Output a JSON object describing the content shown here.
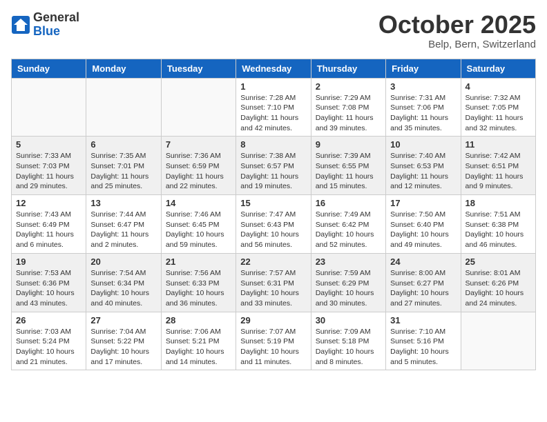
{
  "header": {
    "logo_general": "General",
    "logo_blue": "Blue",
    "month_title": "October 2025",
    "subtitle": "Belp, Bern, Switzerland"
  },
  "weekdays": [
    "Sunday",
    "Monday",
    "Tuesday",
    "Wednesday",
    "Thursday",
    "Friday",
    "Saturday"
  ],
  "weeks": [
    [
      {
        "day": "",
        "info": ""
      },
      {
        "day": "",
        "info": ""
      },
      {
        "day": "",
        "info": ""
      },
      {
        "day": "1",
        "info": "Sunrise: 7:28 AM\nSunset: 7:10 PM\nDaylight: 11 hours\nand 42 minutes."
      },
      {
        "day": "2",
        "info": "Sunrise: 7:29 AM\nSunset: 7:08 PM\nDaylight: 11 hours\nand 39 minutes."
      },
      {
        "day": "3",
        "info": "Sunrise: 7:31 AM\nSunset: 7:06 PM\nDaylight: 11 hours\nand 35 minutes."
      },
      {
        "day": "4",
        "info": "Sunrise: 7:32 AM\nSunset: 7:05 PM\nDaylight: 11 hours\nand 32 minutes."
      }
    ],
    [
      {
        "day": "5",
        "info": "Sunrise: 7:33 AM\nSunset: 7:03 PM\nDaylight: 11 hours\nand 29 minutes."
      },
      {
        "day": "6",
        "info": "Sunrise: 7:35 AM\nSunset: 7:01 PM\nDaylight: 11 hours\nand 25 minutes."
      },
      {
        "day": "7",
        "info": "Sunrise: 7:36 AM\nSunset: 6:59 PM\nDaylight: 11 hours\nand 22 minutes."
      },
      {
        "day": "8",
        "info": "Sunrise: 7:38 AM\nSunset: 6:57 PM\nDaylight: 11 hours\nand 19 minutes."
      },
      {
        "day": "9",
        "info": "Sunrise: 7:39 AM\nSunset: 6:55 PM\nDaylight: 11 hours\nand 15 minutes."
      },
      {
        "day": "10",
        "info": "Sunrise: 7:40 AM\nSunset: 6:53 PM\nDaylight: 11 hours\nand 12 minutes."
      },
      {
        "day": "11",
        "info": "Sunrise: 7:42 AM\nSunset: 6:51 PM\nDaylight: 11 hours\nand 9 minutes."
      }
    ],
    [
      {
        "day": "12",
        "info": "Sunrise: 7:43 AM\nSunset: 6:49 PM\nDaylight: 11 hours\nand 6 minutes."
      },
      {
        "day": "13",
        "info": "Sunrise: 7:44 AM\nSunset: 6:47 PM\nDaylight: 11 hours\nand 2 minutes."
      },
      {
        "day": "14",
        "info": "Sunrise: 7:46 AM\nSunset: 6:45 PM\nDaylight: 10 hours\nand 59 minutes."
      },
      {
        "day": "15",
        "info": "Sunrise: 7:47 AM\nSunset: 6:43 PM\nDaylight: 10 hours\nand 56 minutes."
      },
      {
        "day": "16",
        "info": "Sunrise: 7:49 AM\nSunset: 6:42 PM\nDaylight: 10 hours\nand 52 minutes."
      },
      {
        "day": "17",
        "info": "Sunrise: 7:50 AM\nSunset: 6:40 PM\nDaylight: 10 hours\nand 49 minutes."
      },
      {
        "day": "18",
        "info": "Sunrise: 7:51 AM\nSunset: 6:38 PM\nDaylight: 10 hours\nand 46 minutes."
      }
    ],
    [
      {
        "day": "19",
        "info": "Sunrise: 7:53 AM\nSunset: 6:36 PM\nDaylight: 10 hours\nand 43 minutes."
      },
      {
        "day": "20",
        "info": "Sunrise: 7:54 AM\nSunset: 6:34 PM\nDaylight: 10 hours\nand 40 minutes."
      },
      {
        "day": "21",
        "info": "Sunrise: 7:56 AM\nSunset: 6:33 PM\nDaylight: 10 hours\nand 36 minutes."
      },
      {
        "day": "22",
        "info": "Sunrise: 7:57 AM\nSunset: 6:31 PM\nDaylight: 10 hours\nand 33 minutes."
      },
      {
        "day": "23",
        "info": "Sunrise: 7:59 AM\nSunset: 6:29 PM\nDaylight: 10 hours\nand 30 minutes."
      },
      {
        "day": "24",
        "info": "Sunrise: 8:00 AM\nSunset: 6:27 PM\nDaylight: 10 hours\nand 27 minutes."
      },
      {
        "day": "25",
        "info": "Sunrise: 8:01 AM\nSunset: 6:26 PM\nDaylight: 10 hours\nand 24 minutes."
      }
    ],
    [
      {
        "day": "26",
        "info": "Sunrise: 7:03 AM\nSunset: 5:24 PM\nDaylight: 10 hours\nand 21 minutes."
      },
      {
        "day": "27",
        "info": "Sunrise: 7:04 AM\nSunset: 5:22 PM\nDaylight: 10 hours\nand 17 minutes."
      },
      {
        "day": "28",
        "info": "Sunrise: 7:06 AM\nSunset: 5:21 PM\nDaylight: 10 hours\nand 14 minutes."
      },
      {
        "day": "29",
        "info": "Sunrise: 7:07 AM\nSunset: 5:19 PM\nDaylight: 10 hours\nand 11 minutes."
      },
      {
        "day": "30",
        "info": "Sunrise: 7:09 AM\nSunset: 5:18 PM\nDaylight: 10 hours\nand 8 minutes."
      },
      {
        "day": "31",
        "info": "Sunrise: 7:10 AM\nSunset: 5:16 PM\nDaylight: 10 hours\nand 5 minutes."
      },
      {
        "day": "",
        "info": ""
      }
    ]
  ]
}
